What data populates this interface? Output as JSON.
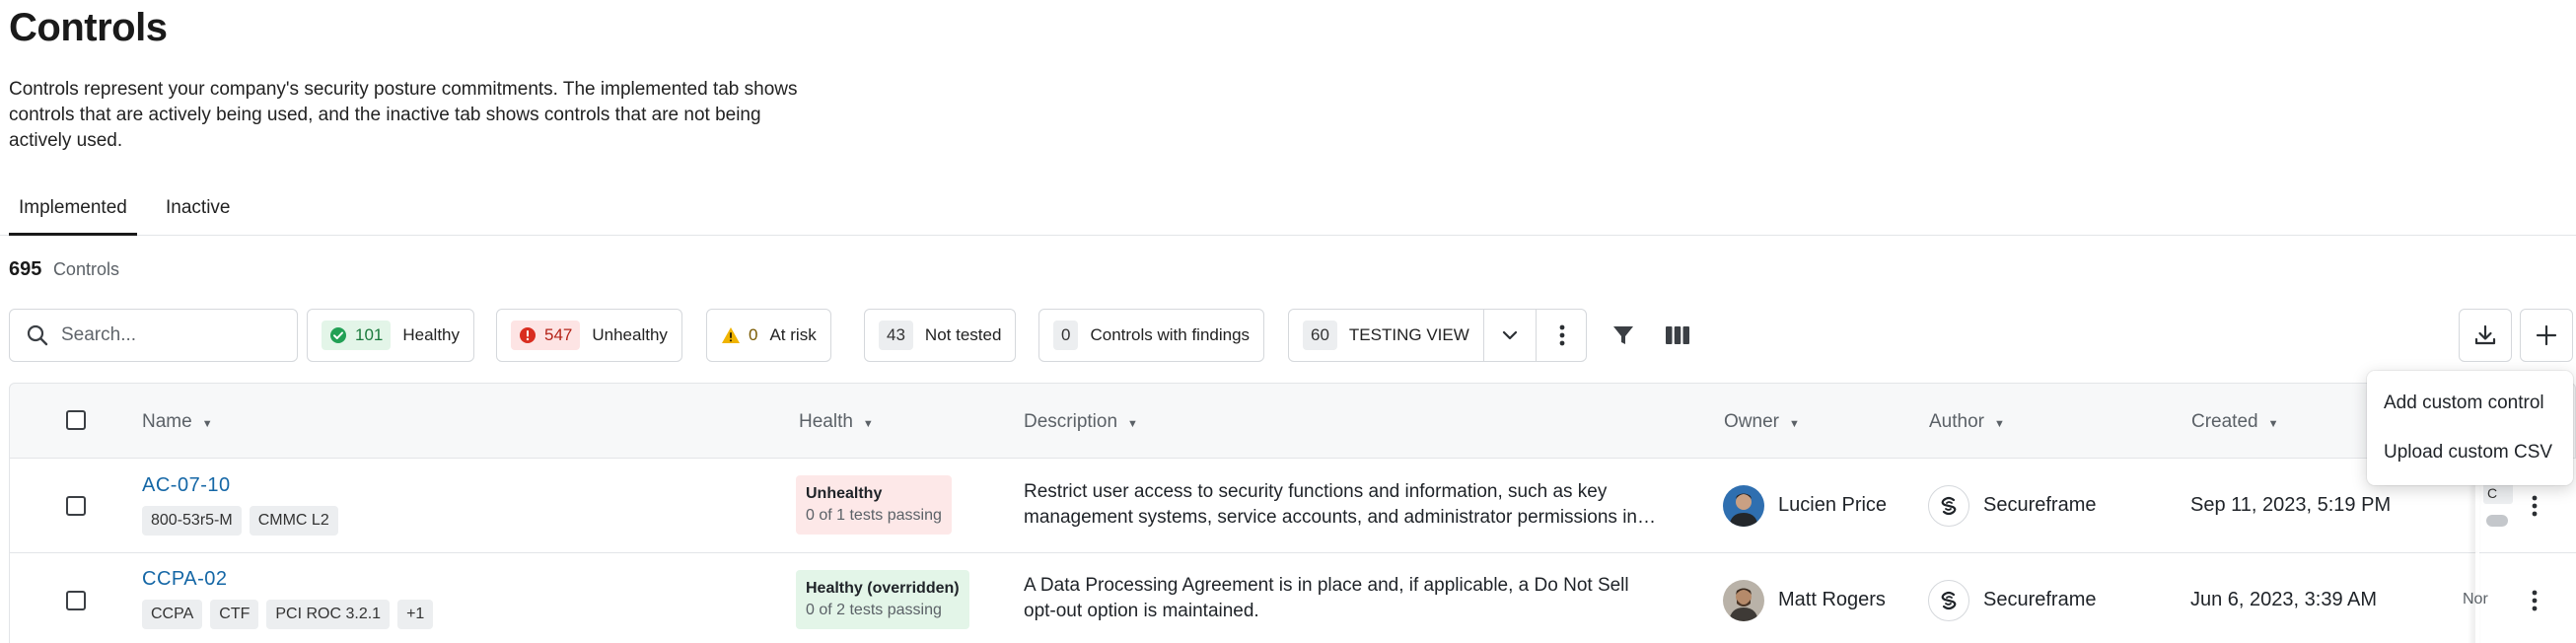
{
  "page": {
    "title": "Controls",
    "description": "Controls represent your company's security posture commitments. The implemented tab shows controls that are actively being used, and the inactive tab shows controls that are not being actively used."
  },
  "tabs": [
    {
      "label": "Implemented",
      "active": true
    },
    {
      "label": "Inactive",
      "active": false
    }
  ],
  "summary": {
    "count": "695",
    "label": "Controls"
  },
  "search": {
    "placeholder": "Search..."
  },
  "filters": [
    {
      "count": "101",
      "label": "Healthy",
      "status": "healthy",
      "icon": "check-circle-icon"
    },
    {
      "count": "547",
      "label": "Unhealthy",
      "status": "unhealthy",
      "icon": "alert-circle-icon"
    },
    {
      "count": "0",
      "label": "At risk",
      "status": "at-risk",
      "icon": "warning-triangle-icon"
    },
    {
      "count": "43",
      "label": "Not tested",
      "status": "not-tested"
    },
    {
      "count": "0",
      "label": "Controls with findings",
      "status": "findings"
    }
  ],
  "view": {
    "count": "60",
    "label": "TESTING VIEW"
  },
  "columns": [
    "Name",
    "Health",
    "Description",
    "Owner",
    "Author",
    "Created"
  ],
  "rows": [
    {
      "id": "AC-07-10",
      "tags": [
        "800-53r5-M",
        "CMMC L2"
      ],
      "health_title": "Unhealthy",
      "health_sub": "0 of 1 tests passing",
      "health_status": "unhealthy",
      "description_line1": "Restrict user access to security functions and information, such as key",
      "description_line2": "management systems, service accounts, and administrator permissions in…",
      "owner": "Lucien Price",
      "author": "Secureframe",
      "created": "Sep 11, 2023, 5:19 PM"
    },
    {
      "id": "CCPA-02",
      "tags": [
        "CCPA",
        "CTF",
        "PCI ROC 3.2.1",
        "+1"
      ],
      "health_title": "Healthy (overridden)",
      "health_sub": "0 of 2 tests passing",
      "health_status": "healthy",
      "description_line1": "A Data Processing Agreement is in place and, if applicable, a Do Not Sell",
      "description_line2": "opt-out option is maintained.",
      "owner": "Matt Rogers",
      "author": "Secureframe",
      "created": "Jun 6, 2023, 3:39 AM"
    }
  ],
  "clipped": {
    "row1": "C",
    "row2": "Nor"
  },
  "add_menu": {
    "items": [
      "Add custom control",
      "Upload custom CSV"
    ]
  },
  "colors": {
    "accent_link": "#1567a6",
    "healthy": "#1b7a3c",
    "unhealthy": "#b42318",
    "at_risk": "#e0a800"
  }
}
